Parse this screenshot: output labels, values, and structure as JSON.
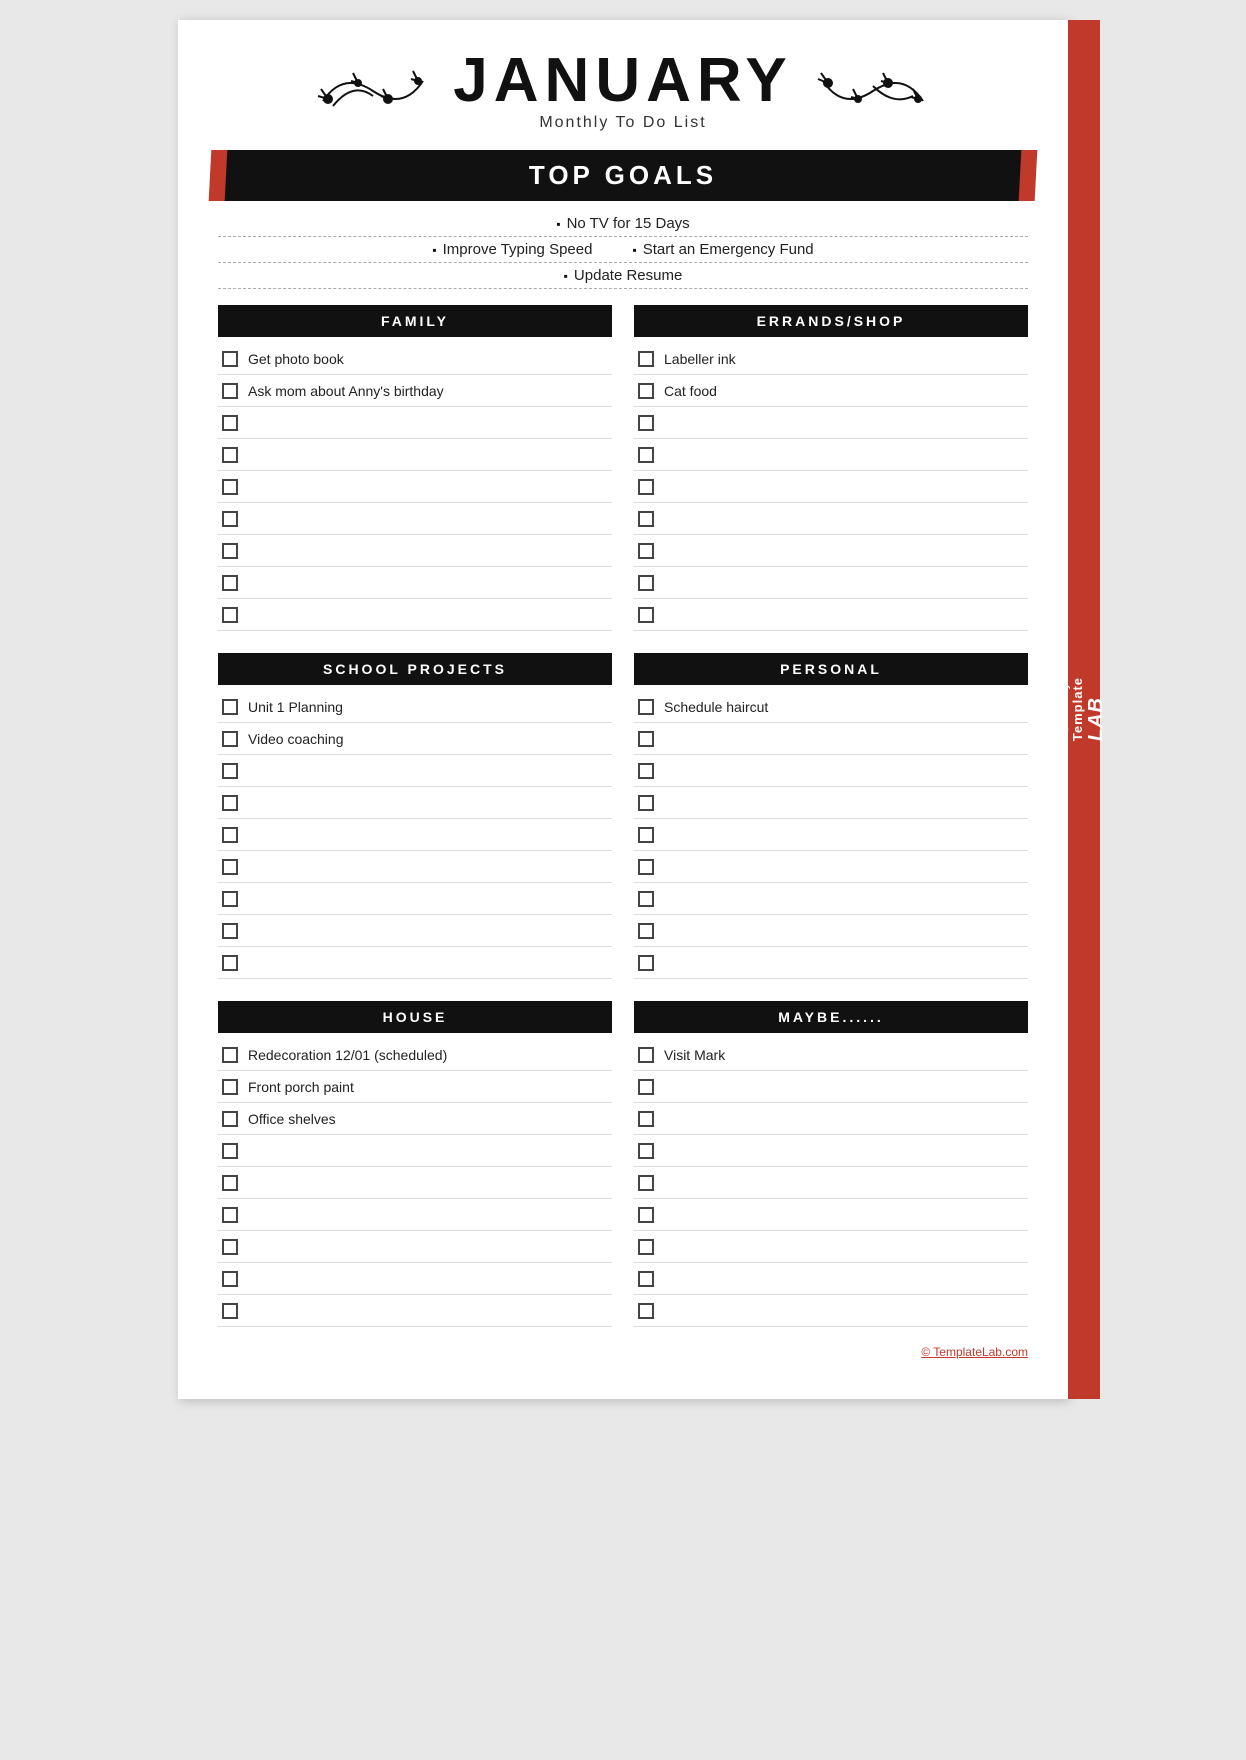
{
  "sideTab": {
    "line1": "TemplateLAB",
    "fullText": "TemplateLAB"
  },
  "header": {
    "month": "JANUARY",
    "subtitle": "Monthly To Do List"
  },
  "topGoals": {
    "label": "TOP GOALS",
    "lines": [
      [
        {
          "text": "No TV for 15 Days"
        }
      ],
      [
        {
          "text": "Improve Typing Speed"
        },
        {
          "text": "Start an Emergency Fund"
        }
      ],
      [
        {
          "text": "Update Resume"
        }
      ]
    ]
  },
  "sections": [
    {
      "row": 1,
      "left": {
        "title": "FAMILY",
        "items": [
          "Get photo book",
          "Ask mom about Anny's birthday",
          "",
          "",
          "",
          "",
          "",
          "",
          ""
        ]
      },
      "right": {
        "title": "ERRANDS/SHOP",
        "items": [
          "Labeller ink",
          "Cat food",
          "",
          "",
          "",
          "",
          "",
          "",
          ""
        ]
      }
    },
    {
      "row": 2,
      "left": {
        "title": "SCHOOL PROJECTS",
        "items": [
          "Unit 1 Planning",
          "Video coaching",
          "",
          "",
          "",
          "",
          "",
          "",
          ""
        ]
      },
      "right": {
        "title": "PERSONAL",
        "items": [
          "Schedule haircut",
          "",
          "",
          "",
          "",
          "",
          "",
          "",
          ""
        ]
      }
    },
    {
      "row": 3,
      "left": {
        "title": "HOUSE",
        "items": [
          "Redecoration 12/01 (scheduled)",
          "Front porch paint",
          "Office shelves",
          "",
          "",
          "",
          "",
          "",
          ""
        ]
      },
      "right": {
        "title": "MAYBE......",
        "items": [
          "Visit Mark",
          "",
          "",
          "",
          "",
          "",
          "",
          "",
          ""
        ]
      }
    }
  ],
  "footer": {
    "text": "© TemplateLab.com"
  }
}
